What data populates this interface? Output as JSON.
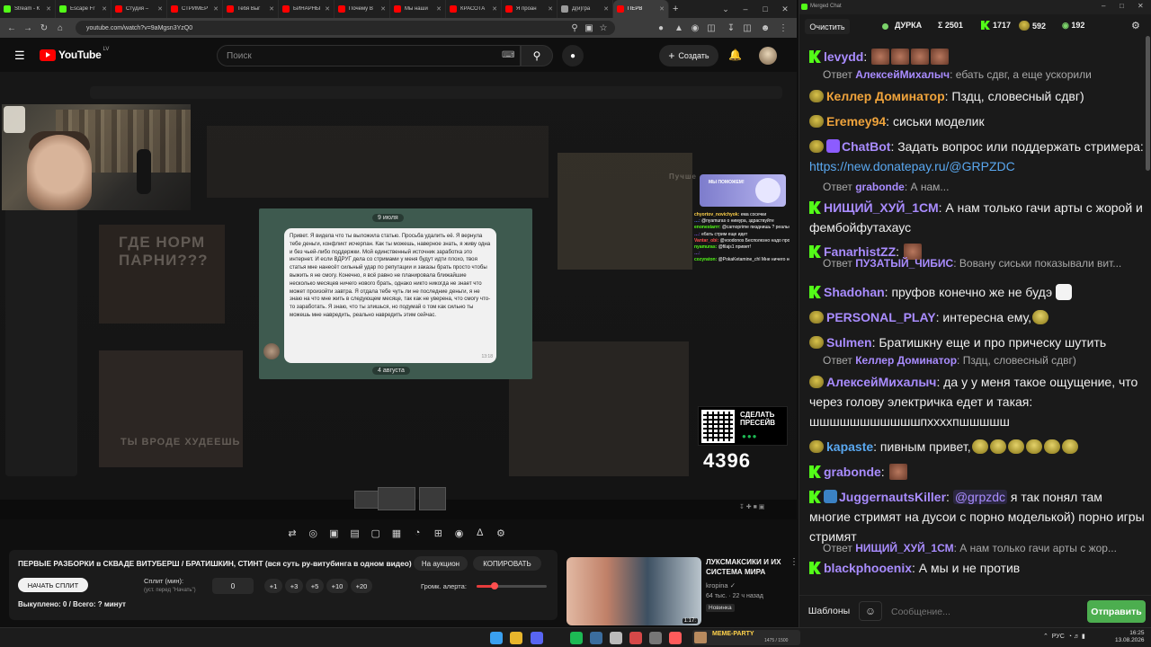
{
  "browser": {
    "tabs": [
      {
        "label": "Stream - К",
        "color": "#53fc18"
      },
      {
        "label": "Escape Fr",
        "color": "#53fc18"
      },
      {
        "label": "Студия –",
        "color": "#ff0000"
      },
      {
        "label": "СТРИМЕР",
        "color": "#ff0000"
      },
      {
        "label": "Тебя Выг",
        "color": "#ff0000"
      },
      {
        "label": "БИНАРНЫ",
        "color": "#ff0000"
      },
      {
        "label": "Почему В",
        "color": "#ff0000"
      },
      {
        "label": "Мы наши",
        "color": "#ff0000"
      },
      {
        "label": "КРАСОТА",
        "color": "#ff0000"
      },
      {
        "label": "Я проан",
        "color": "#ff0000"
      },
      {
        "label": "Д(и)гра",
        "color": "#9a9a9a"
      },
      {
        "label": "ПЕРВ",
        "color": "#ff0000",
        "active": true
      }
    ],
    "new_tab": "+",
    "url": "youtube.com/watch?v=9aMgsn3YzQ0",
    "window_controls": {
      "minimize": "–",
      "maximize": "□",
      "close": "✕",
      "tabs_menu": "⌄"
    }
  },
  "youtube": {
    "logo_text": "YouTube",
    "logo_region": "LV",
    "search_placeholder": "Поиск",
    "create_label": "Создать"
  },
  "stream_overlay": {
    "chat_date_top": "9 июля",
    "chat_date_bottom": "4 августа",
    "chat_message": "Привет. Я видела что ты выложила статью. Просьба удалить её. Я вернула тебе деньги, конфликт исчерпан. Как ты можешь, наверное знать, я живу одна и без чьей-либо поддержки. Мой единственный источник заработка это интернет. И если ВДРУГ дела со стримами у меня будут идти плохо, твоя статья мне нанесёт сильный удар по репутации и заказы брать просто чтобы выжить я не смогу. Конечно, я всё равно не планировала ближайшие несколько месяцев ничего нового брать, однако никто никогда не знает что может произойти завтра. Я отдала тебе чуть ли не последние деньги, я не знаю на что мне жить в следующем месяце, так как не уверена, что смогу что-то заработать. Я знаю, что ты злишься, но подумай о том как сильно ты можешь мне навредить, реально навредить этим сейчас.",
    "chat_time": "13:18",
    "bg_text_1": "ГДЕ НОРМ ПАРНИ???",
    "bg_text_2": "ТЫ ВРОДЕ ХУДЕЕШЬ",
    "bg_text_3": "Пучше",
    "banner_text": "МЫ ПОМОЖЕМ!",
    "mini_chat": [
      {
        "name": "chyortov_novichyok:",
        "text": "ема сосечки",
        "color": "#ffd24a"
      },
      {
        "name": "…:",
        "text": "@nyamuras о нимура, здраствуйте",
        "color": "#5a7bff"
      },
      {
        "name": "enonestarrr:",
        "text": "@carnoprime пизднишь ? реально ? да ну нахуй. держи в курсе",
        "color": "#53fc18"
      },
      {
        "name": "…:",
        "text": "ебать стрим еще идет",
        "color": "#8c5cff"
      },
      {
        "name": "Vantar_obi:",
        "text": "@voodonos Бесполезно надо просить Аэфс",
        "color": "#ff4f4f"
      },
      {
        "name": "nyamuras:",
        "text": "@filаjs1 привет!",
        "color": "#53fc18"
      },
      {
        "name": "…:",
        "text": "",
        "color": "#8c5cff"
      },
      {
        "name": "cozyraton:",
        "text": "@PokaKetamine_chl Мне ничего не достанется",
        "color": "#53fc18"
      }
    ],
    "qr_title": "СДЕЛАТЬ ПРЕСЕЙВ",
    "counter": "4396"
  },
  "controls": {
    "icons": [
      "repeat-icon",
      "broadcast-icon",
      "screen-icon",
      "clapper-icon",
      "crop-icon",
      "film-icon",
      "speed-icon",
      "add-screen-icon",
      "camera-icon",
      "flask-icon",
      "settings-icon"
    ],
    "glyphs": [
      "⇄",
      "◎",
      "▣",
      "▤",
      "▢",
      "▦",
      "◔",
      "⊞",
      "◉",
      "∆",
      "⚙"
    ]
  },
  "info_panel": {
    "title": "ПЕРВЫЕ РАЗБОРКИ в СКВАДЕ ВИТУБЕРШ / БРАТИШКИН, СТИНТ (вся суть ру-витубинга в одном видео)",
    "auction_label": "На аукцион",
    "copy_label": "КОПИРОВАТЬ",
    "start_split_label": "НАЧАТЬ СПЛИТ",
    "split_label": "Сплит (мин):",
    "split_hint": "(уст. перед \"Начать\")",
    "split_value": "0",
    "increments": [
      "+1",
      "+3",
      "+5",
      "+10",
      "+20"
    ],
    "volume_label": "Громк. алерта:",
    "volume_fraction": 0.25,
    "bought": "Выкуплено: 0 / Всего: ? минут"
  },
  "recommendation": {
    "title": "ЛУКСМАКСИКИ И ИХ СИСТЕМА МИРА",
    "channel": "kropina",
    "meta": "64 тыс. · 22 ч назад",
    "badge": "Новинка",
    "duration": "1:17:"
  },
  "chat": {
    "app_title": "Merged Chat",
    "clear_label": "Очистить",
    "stream_name": "ДУРКА",
    "total_viewers": "Σ 2501",
    "kick_viewers": "1717",
    "twitch_viewers": "592",
    "other_viewers": "192",
    "messages": [
      {
        "kind": "msg",
        "platform": "kick",
        "user": "levydd",
        "color": "#a98cff",
        "text": "",
        "emotes": 4
      },
      {
        "kind": "reply",
        "to": "АлексейМихалыч",
        "text": ": ебать сдвг, а еще ускорили"
      },
      {
        "kind": "msg",
        "platform": "face",
        "user": "Келлер Доминатор",
        "color": "#f0a43c",
        "text": " Пздц, словесный сдвг)"
      },
      {
        "kind": "msg",
        "platform": "face",
        "user": "Eremey94",
        "color": "#f0a43c",
        "text": " сиськи моделик"
      },
      {
        "kind": "msg",
        "platform": "face",
        "user": "ChatBot",
        "color": "#a98cff",
        "badge": "ai",
        "text": " Задать вопрос или поддержать стримера: ",
        "link": "https://new.donatepay.ru/@GRPZDC"
      },
      {
        "kind": "reply",
        "to": "grabonde",
        "text": ": А нам..."
      },
      {
        "kind": "msg",
        "platform": "kick",
        "user": "НИЩИЙ_ХУЙ_1СМ",
        "color": "#a98cff",
        "text": " А нам только гачи арты с жорой и фембойфутахаус"
      },
      {
        "kind": "msg",
        "platform": "kick",
        "user": "FanarhistZZ",
        "color": "#a98cff",
        "text": "",
        "emotes": 1
      },
      {
        "kind": "reply",
        "to": "ПУЗАТЫЙ_ЧИБИС",
        "text": ": Вовану сиськи показывали вит..."
      },
      {
        "kind": "msg",
        "platform": "kick",
        "user": "Shadohan",
        "color": "#a98cff",
        "text": " пруфов конечно же не будэ",
        "white_emote": true
      },
      {
        "kind": "msg",
        "platform": "face",
        "user": "PERSONAL_PLAY",
        "color": "#a98cff",
        "text": " интересна ему,",
        "gold_emotes": 1
      },
      {
        "kind": "msg",
        "platform": "face",
        "user": "Sulmen",
        "color": "#a98cff",
        "text": " Братишкну еще и про прическу шутить"
      },
      {
        "kind": "reply",
        "to": "Келлер Доминатор",
        "text": ": Пздц, словесный сдвг)"
      },
      {
        "kind": "msg",
        "platform": "face",
        "user": "АлексейМихалыч",
        "color": "#a98cff",
        "text": " да у у меня такое ощущение, что через голову электричка едет и такая: шшшшшшшшшшшпххххпшшшшш"
      },
      {
        "kind": "msg",
        "platform": "face",
        "user": "kapaste",
        "color": "#5aa8f0",
        "text": " пивным привет,",
        "gold_emotes": 6
      },
      {
        "kind": "msg",
        "platform": "kick",
        "user": "grabonde",
        "color": "#a98cff",
        "text": "",
        "emotes": 1
      },
      {
        "kind": "msg",
        "platform": "kick",
        "user": "JuggernautsKiller",
        "color": "#a98cff",
        "badge": "jump",
        "mention": "@grpzdc",
        "text": " я так понял там многие стримят на дусои с порно моделькой) порно игры стримят"
      },
      {
        "kind": "reply",
        "to": "НИЩИЙ_ХУЙ_1СМ",
        "text": ": А нам только гачи арты с жор..."
      },
      {
        "kind": "msg",
        "platform": "kick",
        "user": "blackphooenix",
        "color": "#a98cff",
        "text": " А мы и не против"
      }
    ],
    "reply_prefix": "Ответ",
    "templates_label": "Шаблоны",
    "input_placeholder": "Сообщение...",
    "send_label": "Отправить"
  },
  "taskbar": {
    "widget_title": "MEME-PARTY",
    "widget_value": "1475 / 1500",
    "tray_lang": "РУС",
    "time": "16:25",
    "date": "13.08.2026",
    "icons": [
      {
        "name": "windows-start-icon",
        "color": "#3aa0f0"
      },
      {
        "name": "chrome-icon",
        "color": "#e8b62c"
      },
      {
        "name": "discord-icon",
        "color": "#5865f2"
      },
      {
        "name": "spotify-icon",
        "color": "#1db954"
      },
      {
        "name": "steam-icon",
        "color": "#3b6d9e"
      },
      {
        "name": "github-icon",
        "color": "#bbbbbb"
      },
      {
        "name": "obs-icon",
        "color": "#d64848"
      },
      {
        "name": "app-icon",
        "color": "#777777"
      },
      {
        "name": "browser-icon",
        "color": "#ff5b5b"
      },
      {
        "name": "files-icon",
        "color": "#4bb56a"
      }
    ]
  }
}
